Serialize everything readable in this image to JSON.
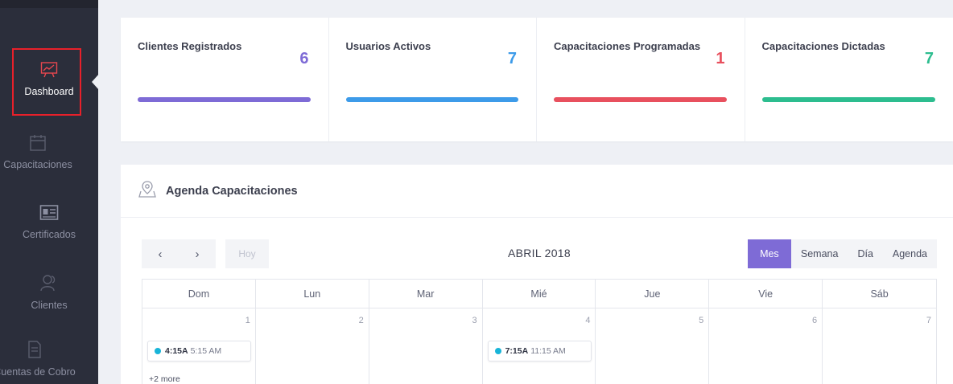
{
  "sidebar": {
    "items": [
      {
        "label": "Dashboard",
        "icon": "presentation-chart-icon",
        "active": true
      },
      {
        "label": "Capacitaciones",
        "icon": "calendar-icon",
        "active": false
      },
      {
        "label": "Certificados",
        "icon": "id-card-icon",
        "active": false
      },
      {
        "label": "Clientes",
        "icon": "users-icon",
        "active": false
      },
      {
        "label": "Cuentas de Cobro",
        "icon": "document-icon",
        "active": false
      }
    ]
  },
  "stats": [
    {
      "title": "Clientes Registrados",
      "value": "6",
      "color": "#7e6bd6"
    },
    {
      "title": "Usuarios Activos",
      "value": "7",
      "color": "#3d9be9"
    },
    {
      "title": "Capacitaciones Programadas",
      "value": "1",
      "color": "#e8505e"
    },
    {
      "title": "Capacitaciones Dictadas",
      "value": "7",
      "color": "#2dbd8f"
    }
  ],
  "agenda": {
    "title": "Agenda Capacitaciones",
    "icon": "map-pin-icon",
    "toolbar": {
      "prev": "‹",
      "next": "›",
      "today": "Hoy",
      "month_title": "ABRIL 2018",
      "views": [
        "Mes",
        "Semana",
        "Día",
        "Agenda"
      ],
      "active_view": "Mes"
    },
    "weekdays": [
      "Dom",
      "Lun",
      "Mar",
      "Mié",
      "Jue",
      "Vie",
      "Sáb"
    ],
    "days": [
      "1",
      "2",
      "3",
      "4",
      "5",
      "6",
      "7"
    ],
    "events": [
      {
        "day": "1",
        "start": "4:15A",
        "end": "5:15 AM"
      },
      {
        "day": "4",
        "start": "7:15A",
        "end": "11:15 AM"
      }
    ],
    "more_label": "+2 more"
  },
  "colors": {
    "sidebar_bg": "#2b2e3b",
    "accent": "#7e6bd6",
    "event_dot": "#18b4d8",
    "active_outline": "#e8202a"
  }
}
